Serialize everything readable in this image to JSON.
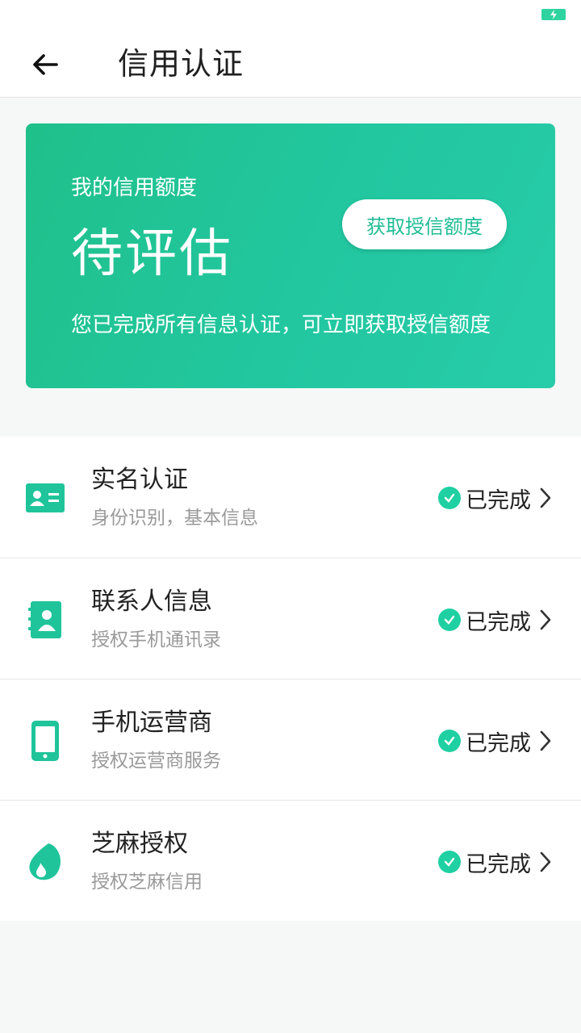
{
  "status_bar": {
    "battery_icon": "battery-charging-icon",
    "accent": "#2fd39f"
  },
  "appbar": {
    "back_icon": "arrow-left-icon",
    "title": "信用认证"
  },
  "credit_card": {
    "label": "我的信用额度",
    "value": "待评估",
    "button_label": "获取授信额度",
    "note": "您已完成所有信息认证，可立即获取授信额度",
    "gradient_start": "#20c08a",
    "gradient_end": "#27cca9"
  },
  "items": [
    {
      "icon": "id-card-icon",
      "title": "实名认证",
      "subtitle": "身份识别，基本信息",
      "status": "已完成"
    },
    {
      "icon": "contacts-book-icon",
      "title": "联系人信息",
      "subtitle": "授权手机通讯录",
      "status": "已完成"
    },
    {
      "icon": "mobile-phone-icon",
      "title": "手机运营商",
      "subtitle": "授权运营商服务",
      "status": "已完成"
    },
    {
      "icon": "sesame-icon",
      "title": "芝麻授权",
      "subtitle": "授权芝麻信用",
      "status": "已完成"
    }
  ],
  "colors": {
    "primary": "#1fc49a",
    "check": "#1fd0a2",
    "text": "#222222",
    "subtext": "#9a9a9a"
  }
}
